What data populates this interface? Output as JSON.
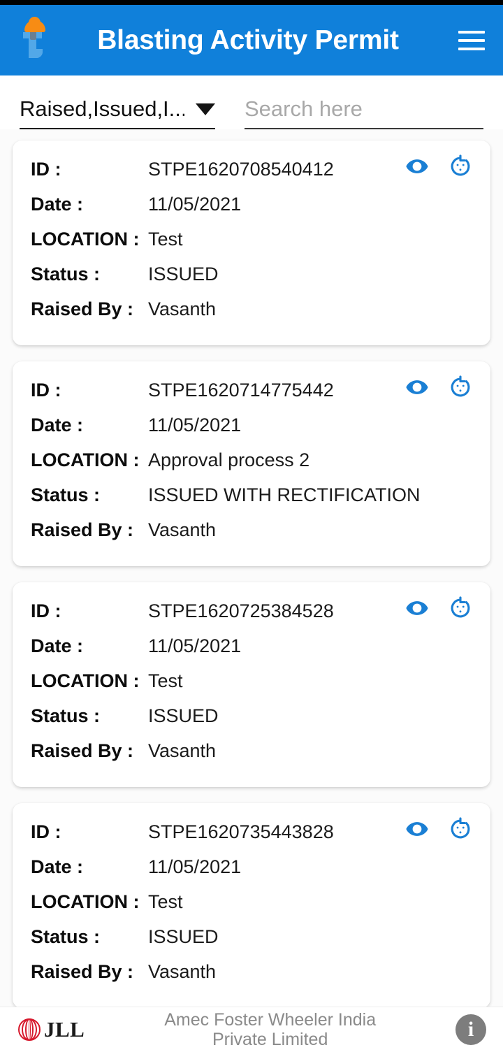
{
  "app": {
    "title": "Blasting Activity Permit",
    "logo_icon": "hardhat-t-logo",
    "menu_icon": "hamburger-menu-icon",
    "header_color": "#1080da"
  },
  "filter": {
    "status_filter_value": "Raised,Issued,I...",
    "caret_icon": "chevron-down-icon",
    "search_placeholder": "Search here",
    "search_value": ""
  },
  "row_labels": {
    "id": "ID :",
    "date": "Date :",
    "location": "LOCATION :",
    "status": "Status :",
    "raised_by": "Raised By :"
  },
  "actions": {
    "view_icon": "eye-icon",
    "history_icon": "history-clock-icon",
    "icon_color": "#1a7fd4"
  },
  "permits": [
    {
      "id": "STPE1620708540412",
      "date": "11/05/2021",
      "location": "Test",
      "status": "ISSUED",
      "raised_by": "Vasanth"
    },
    {
      "id": "STPE1620714775442",
      "date": "11/05/2021",
      "location": "Approval process 2",
      "status": "ISSUED WITH RECTIFICATION",
      "raised_by": "Vasanth"
    },
    {
      "id": "STPE1620725384528",
      "date": "11/05/2021",
      "location": "Test",
      "status": "ISSUED",
      "raised_by": "Vasanth"
    },
    {
      "id": "STPE1620735443828",
      "date": "11/05/2021",
      "location": "Test",
      "status": "ISSUED",
      "raised_by": "Vasanth"
    }
  ],
  "footer": {
    "brand_logo_icon": "jll-logo",
    "brand_text": "JLL",
    "company_line1": "Amec Foster Wheeler India",
    "company_line2": "Private Limited",
    "info_icon": "info-icon",
    "info_label": "i"
  }
}
